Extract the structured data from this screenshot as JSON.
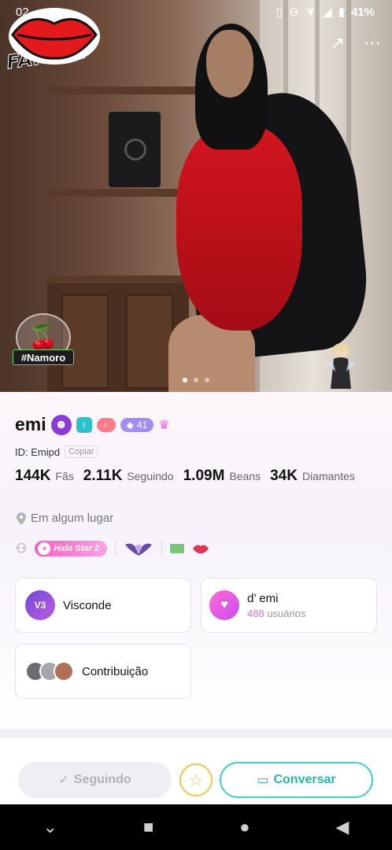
{
  "status_bar": {
    "time": "02",
    "battery": "41%"
  },
  "brand": {
    "text": "FAPEXY"
  },
  "hero": {
    "badge_tag": "#Namoro",
    "page_count": 3,
    "active_page": 0
  },
  "profile": {
    "name": "emi",
    "level": "41",
    "id_label": "ID: Emipd",
    "copy_label": "Copiar",
    "stats": [
      {
        "value": "144K",
        "label": "Fãs"
      },
      {
        "value": "2.11K",
        "label": "Seguindo"
      },
      {
        "value": "1.09M",
        "label": "Beans"
      },
      {
        "value": "34K",
        "label": "Diamantes"
      }
    ],
    "location": "Em algum lugar",
    "halo_badge": "Halo Star 2"
  },
  "cards": {
    "vip": {
      "icon_label": "V3",
      "title": "Visconde"
    },
    "fans": {
      "title": "d’ emi",
      "count": "488",
      "count_label": "usuários"
    },
    "contrib": {
      "title": "Contribuição"
    }
  },
  "actions": {
    "following_label": "Seguindo",
    "chat_label": "Conversar"
  },
  "colors": {
    "accent_pink": "#f65ec4",
    "accent_teal": "#3fd0c9",
    "star_gold": "#f0c54b"
  }
}
